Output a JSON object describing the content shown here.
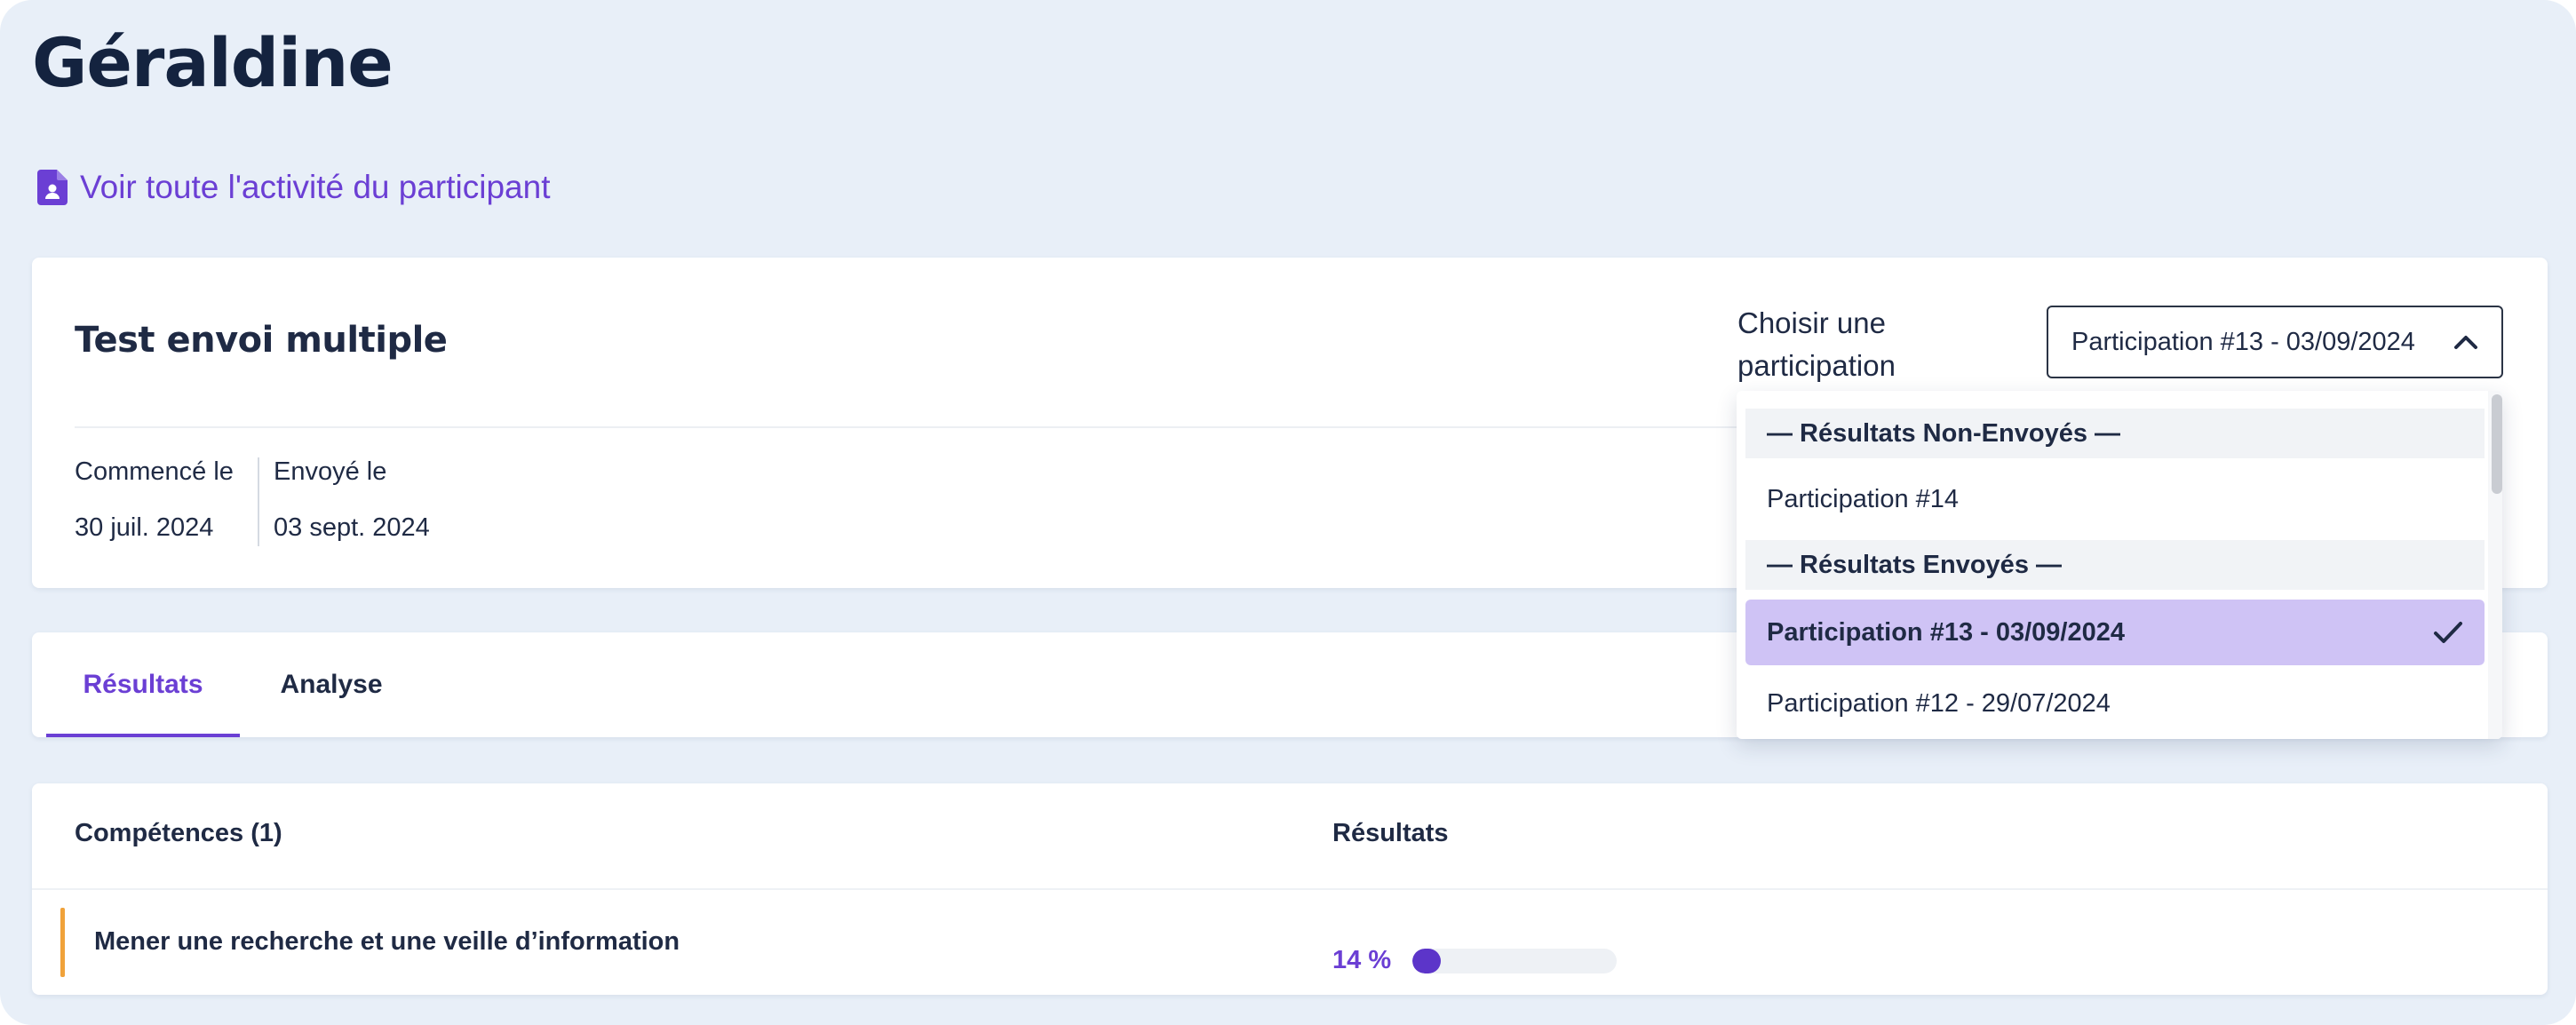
{
  "page": {
    "title": "Géraldine",
    "activity_link": "Voir toute l'activité du participant"
  },
  "header_card": {
    "title": "Test envoi multiple",
    "started_label": "Commencé le",
    "started_value": "30 juil. 2024",
    "sent_label": "Envoyé le",
    "sent_value": "03 sept. 2024",
    "select_label": "Choisir une participation",
    "select_value": "Participation #13 - 03/09/2024"
  },
  "dropdown": {
    "group_unsent": "— Résultats Non-Envoyés —",
    "option_14": "Participation #14",
    "group_sent": "— Résultats Envoyés —",
    "option_13": "Participation #13 - 03/09/2024",
    "option_12": "Participation #12 - 29/07/2024"
  },
  "tabs": [
    "Résultats",
    "Analyse"
  ],
  "table": {
    "col_competences": "Compétences (1)",
    "col_results": "Résultats",
    "rows": [
      {
        "name": "Mener une recherche et une veille d’information",
        "percent_label": "14 %",
        "progress": 0.14
      }
    ]
  },
  "colors": {
    "accent": "#6b3fd4",
    "row_accent": "#f0a23a",
    "selected_bg": "#cfc3f5",
    "page_bg": "#e8eff8"
  },
  "icons": {
    "activity": "user-document-icon",
    "select": "chevron-up-icon",
    "selected": "check-icon"
  }
}
